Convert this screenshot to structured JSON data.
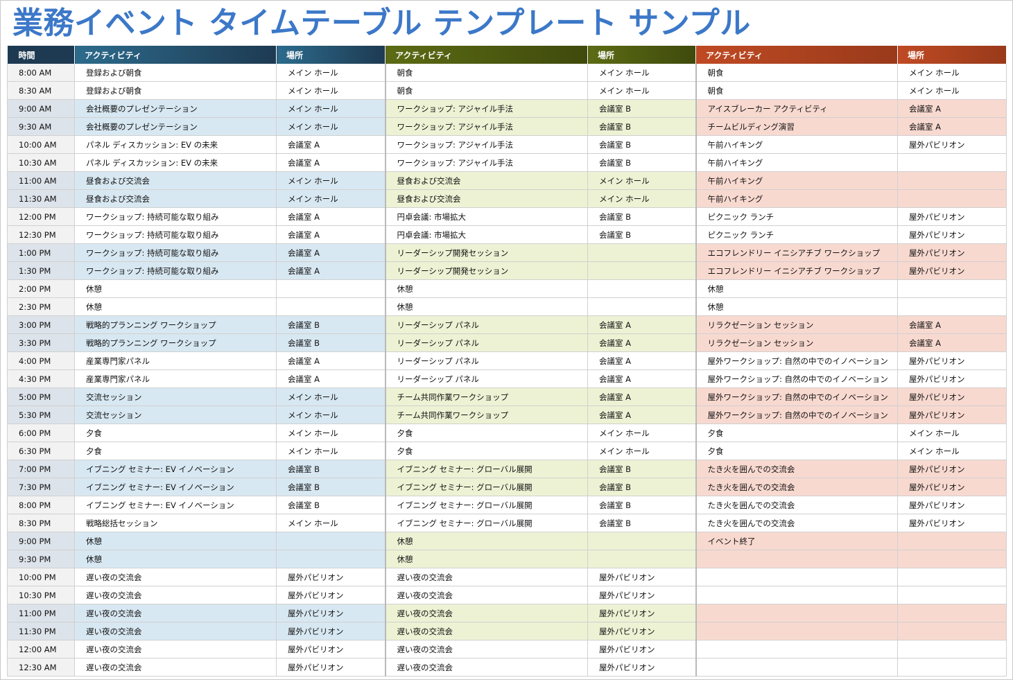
{
  "title": "業務イベント タイムテーブル テンプレート サンプル",
  "colors": {
    "title": "#3c78c8",
    "header_time": "#1e3a52",
    "header_g1": [
      "#2c6b8c",
      "#1e3a52"
    ],
    "header_g2": [
      "#5c6b14",
      "#3f4a0c"
    ],
    "header_g3": [
      "#bf4a24",
      "#993a1a"
    ],
    "time_bg": "#f2f2f2",
    "time_bg_shaded": "#dde3ea",
    "shade_g1": "#d8e8f2",
    "shade_g2": "#edf2d4",
    "shade_g3": "#f8d9d0"
  },
  "headers": {
    "time": "時間",
    "groups": [
      {
        "activity": "アクティビティ",
        "location": "場所"
      },
      {
        "activity": "アクティビティ",
        "location": "場所"
      },
      {
        "activity": "アクティビティ",
        "location": "場所"
      }
    ]
  },
  "shaded_rows": [
    2,
    3,
    6,
    7,
    10,
    11,
    14,
    15,
    18,
    19,
    22,
    23,
    26,
    27,
    30,
    31
  ],
  "rows": [
    {
      "time": "8:00 AM",
      "cells": [
        [
          "登録および朝食",
          "メイン ホール"
        ],
        [
          "朝食",
          "メイン ホール"
        ],
        [
          "朝食",
          "メイン ホール"
        ]
      ]
    },
    {
      "time": "8:30 AM",
      "cells": [
        [
          "登録および朝食",
          "メイン ホール"
        ],
        [
          "朝食",
          "メイン ホール"
        ],
        [
          "朝食",
          "メイン ホール"
        ]
      ]
    },
    {
      "time": "9:00 AM",
      "cells": [
        [
          "会社概要のプレゼンテーション",
          "メイン ホール"
        ],
        [
          "ワークショップ: アジャイル手法",
          "会議室 B"
        ],
        [
          "アイスブレーカー アクティビティ",
          "会議室 A"
        ]
      ]
    },
    {
      "time": "9:30 AM",
      "cells": [
        [
          "会社概要のプレゼンテーション",
          "メイン ホール"
        ],
        [
          "ワークショップ: アジャイル手法",
          "会議室 B"
        ],
        [
          "チームビルディング演習",
          "会議室 A"
        ]
      ]
    },
    {
      "time": "10:00 AM",
      "cells": [
        [
          "パネル ディスカッション: EV の未来",
          "会議室 A"
        ],
        [
          "ワークショップ: アジャイル手法",
          "会議室 B"
        ],
        [
          "午前ハイキング",
          "屋外パビリオン"
        ]
      ]
    },
    {
      "time": "10:30 AM",
      "cells": [
        [
          "パネル ディスカッション: EV の未来",
          "会議室 A"
        ],
        [
          "ワークショップ: アジャイル手法",
          "会議室 B"
        ],
        [
          "午前ハイキング",
          ""
        ]
      ]
    },
    {
      "time": "11:00 AM",
      "cells": [
        [
          "昼食および交流会",
          "メイン ホール"
        ],
        [
          "昼食および交流会",
          "メイン ホール"
        ],
        [
          "午前ハイキング",
          ""
        ]
      ]
    },
    {
      "time": "11:30 AM",
      "cells": [
        [
          "昼食および交流会",
          "メイン ホール"
        ],
        [
          "昼食および交流会",
          "メイン ホール"
        ],
        [
          "午前ハイキング",
          ""
        ]
      ]
    },
    {
      "time": "12:00 PM",
      "cells": [
        [
          "ワークショップ: 持続可能な取り組み",
          "会議室 A"
        ],
        [
          "円卓会議: 市場拡大",
          "会議室 B"
        ],
        [
          "ピクニック ランチ",
          "屋外パビリオン"
        ]
      ]
    },
    {
      "time": "12:30 PM",
      "cells": [
        [
          "ワークショップ: 持続可能な取り組み",
          "会議室 A"
        ],
        [
          "円卓会議: 市場拡大",
          "会議室 B"
        ],
        [
          "ピクニック ランチ",
          "屋外パビリオン"
        ]
      ]
    },
    {
      "time": "1:00 PM",
      "cells": [
        [
          "ワークショップ: 持続可能な取り組み",
          "会議室 A"
        ],
        [
          "リーダーシップ開発セッション",
          ""
        ],
        [
          "エコフレンドリー イニシアチブ ワークショップ",
          "屋外パビリオン"
        ]
      ]
    },
    {
      "time": "1:30 PM",
      "cells": [
        [
          "ワークショップ: 持続可能な取り組み",
          "会議室 A"
        ],
        [
          "リーダーシップ開発セッション",
          ""
        ],
        [
          "エコフレンドリー イニシアチブ ワークショップ",
          "屋外パビリオン"
        ]
      ]
    },
    {
      "time": "2:00 PM",
      "cells": [
        [
          "休憩",
          ""
        ],
        [
          "休憩",
          ""
        ],
        [
          "休憩",
          ""
        ]
      ]
    },
    {
      "time": "2:30 PM",
      "cells": [
        [
          "休憩",
          ""
        ],
        [
          "休憩",
          ""
        ],
        [
          "休憩",
          ""
        ]
      ]
    },
    {
      "time": "3:00 PM",
      "cells": [
        [
          "戦略的プランニング ワークショップ",
          "会議室 B"
        ],
        [
          "リーダーシップ パネル",
          "会議室 A"
        ],
        [
          "リラクゼーション セッション",
          "会議室 A"
        ]
      ]
    },
    {
      "time": "3:30 PM",
      "cells": [
        [
          "戦略的プランニング ワークショップ",
          "会議室 B"
        ],
        [
          "リーダーシップ パネル",
          "会議室 A"
        ],
        [
          "リラクゼーション セッション",
          "会議室 A"
        ]
      ]
    },
    {
      "time": "4:00 PM",
      "cells": [
        [
          "産業専門家パネル",
          "会議室 A"
        ],
        [
          "リーダーシップ パネル",
          "会議室 A"
        ],
        [
          "屋外ワークショップ: 自然の中でのイノベーション",
          "屋外パビリオン"
        ]
      ]
    },
    {
      "time": "4:30 PM",
      "cells": [
        [
          "産業専門家パネル",
          "会議室 A"
        ],
        [
          "リーダーシップ パネル",
          "会議室 A"
        ],
        [
          "屋外ワークショップ: 自然の中でのイノベーション",
          "屋外パビリオン"
        ]
      ]
    },
    {
      "time": "5:00 PM",
      "cells": [
        [
          "交流セッション",
          "メイン ホール"
        ],
        [
          "チーム共同作業ワークショップ",
          "会議室 A"
        ],
        [
          "屋外ワークショップ: 自然の中でのイノベーション",
          "屋外パビリオン"
        ]
      ]
    },
    {
      "time": "5:30 PM",
      "cells": [
        [
          "交流セッション",
          "メイン ホール"
        ],
        [
          "チーム共同作業ワークショップ",
          "会議室 A"
        ],
        [
          "屋外ワークショップ: 自然の中でのイノベーション",
          "屋外パビリオン"
        ]
      ]
    },
    {
      "time": "6:00 PM",
      "cells": [
        [
          "夕食",
          "メイン ホール"
        ],
        [
          "夕食",
          "メイン ホール"
        ],
        [
          "夕食",
          "メイン ホール"
        ]
      ]
    },
    {
      "time": "6:30 PM",
      "cells": [
        [
          "夕食",
          "メイン ホール"
        ],
        [
          "夕食",
          "メイン ホール"
        ],
        [
          "夕食",
          "メイン ホール"
        ]
      ]
    },
    {
      "time": "7:00 PM",
      "cells": [
        [
          "イブニング セミナー: EV イノベーション",
          "会議室 B"
        ],
        [
          "イブニング セミナー: グローバル展開",
          "会議室 B"
        ],
        [
          "たき火を囲んでの交流会",
          "屋外パビリオン"
        ]
      ]
    },
    {
      "time": "7:30 PM",
      "cells": [
        [
          "イブニング セミナー: EV イノベーション",
          "会議室 B"
        ],
        [
          "イブニング セミナー: グローバル展開",
          "会議室 B"
        ],
        [
          "たき火を囲んでの交流会",
          "屋外パビリオン"
        ]
      ]
    },
    {
      "time": "8:00 PM",
      "cells": [
        [
          "イブニング セミナー: EV イノベーション",
          "会議室 B"
        ],
        [
          "イブニング セミナー: グローバル展開",
          "会議室 B"
        ],
        [
          "たき火を囲んでの交流会",
          "屋外パビリオン"
        ]
      ]
    },
    {
      "time": "8:30 PM",
      "cells": [
        [
          "戦略総括セッション",
          "メイン ホール"
        ],
        [
          "イブニング セミナー: グローバル展開",
          "会議室 B"
        ],
        [
          "たき火を囲んでの交流会",
          "屋外パビリオン"
        ]
      ]
    },
    {
      "time": "9:00 PM",
      "cells": [
        [
          "休憩",
          ""
        ],
        [
          "休憩",
          ""
        ],
        [
          "イベント終了",
          ""
        ]
      ]
    },
    {
      "time": "9:30 PM",
      "cells": [
        [
          "休憩",
          ""
        ],
        [
          "休憩",
          ""
        ],
        [
          "",
          ""
        ]
      ]
    },
    {
      "time": "10:00 PM",
      "cells": [
        [
          "遅い夜の交流会",
          "屋外パビリオン"
        ],
        [
          "遅い夜の交流会",
          "屋外パビリオン"
        ],
        [
          "",
          ""
        ]
      ]
    },
    {
      "time": "10:30 PM",
      "cells": [
        [
          "遅い夜の交流会",
          "屋外パビリオン"
        ],
        [
          "遅い夜の交流会",
          "屋外パビリオン"
        ],
        [
          "",
          ""
        ]
      ]
    },
    {
      "time": "11:00 PM",
      "cells": [
        [
          "遅い夜の交流会",
          "屋外パビリオン"
        ],
        [
          "遅い夜の交流会",
          "屋外パビリオン"
        ],
        [
          "",
          ""
        ]
      ]
    },
    {
      "time": "11:30 PM",
      "cells": [
        [
          "遅い夜の交流会",
          "屋外パビリオン"
        ],
        [
          "遅い夜の交流会",
          "屋外パビリオン"
        ],
        [
          "",
          ""
        ]
      ]
    },
    {
      "time": "12:00 AM",
      "cells": [
        [
          "遅い夜の交流会",
          "屋外パビリオン"
        ],
        [
          "遅い夜の交流会",
          "屋外パビリオン"
        ],
        [
          "",
          ""
        ]
      ]
    },
    {
      "time": "12:30 AM",
      "cells": [
        [
          "遅い夜の交流会",
          "屋外パビリオン"
        ],
        [
          "遅い夜の交流会",
          "屋外パビリオン"
        ],
        [
          "",
          ""
        ]
      ]
    }
  ]
}
